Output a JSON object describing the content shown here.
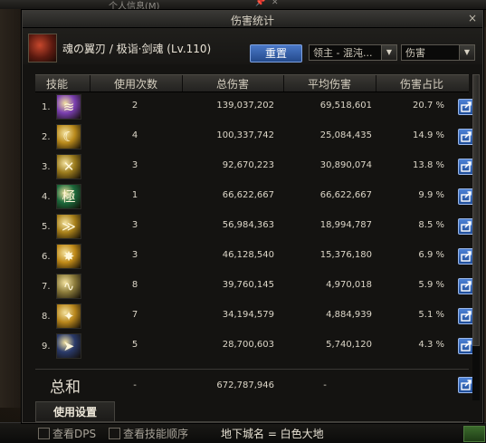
{
  "background": {
    "window_title": "个人信息(M)",
    "checkboxes": [
      {
        "label": "查看DPS",
        "checked": false
      },
      {
        "label": "查看技能顺序",
        "checked": false
      }
    ],
    "dungeon_text": "地下城名 = 白色大地"
  },
  "dialog": {
    "title": "伤害统计",
    "close_symbol": "×",
    "character_name": "魂の翼刃 / 极诣·剑魂 (Lv.110)",
    "reset_label": "重置",
    "target_select": "领主 - 混沌...",
    "metric_select": "伤害",
    "select_arrow": "▼",
    "columns": [
      "技能",
      "使用次数",
      "总伤害",
      "平均伤害",
      "伤害占比"
    ],
    "rows": [
      {
        "rank": "1.",
        "icon": "slash-wave-icon",
        "color": "#7a3fb0",
        "uses": "2",
        "total": "139,037,202",
        "avg": "69,518,601",
        "pct": "20.7 %"
      },
      {
        "rank": "2.",
        "icon": "crescent-slash-icon",
        "color": "#b98a1c",
        "uses": "4",
        "total": "100,337,742",
        "avg": "25,084,435",
        "pct": "14.9 %"
      },
      {
        "rank": "3.",
        "icon": "cross-blade-icon",
        "color": "#9a7a1c",
        "uses": "3",
        "total": "92,670,223",
        "avg": "30,890,074",
        "pct": "13.8 %"
      },
      {
        "rank": "4.",
        "icon": "kanji-ultimate-icon",
        "color": "#1c6a3c",
        "uses": "1",
        "total": "66,622,667",
        "avg": "66,622,667",
        "pct": "9.9 %"
      },
      {
        "rank": "5.",
        "icon": "triple-wave-icon",
        "color": "#a8801a",
        "uses": "3",
        "total": "56,984,363",
        "avg": "18,994,787",
        "pct": "8.5 %"
      },
      {
        "rank": "6.",
        "icon": "burst-strike-icon",
        "color": "#c08a18",
        "uses": "3",
        "total": "46,128,540",
        "avg": "15,376,180",
        "pct": "6.9 %"
      },
      {
        "rank": "7.",
        "icon": "flowing-blade-icon",
        "color": "#8a7a3a",
        "uses": "8",
        "total": "39,760,145",
        "avg": "4,970,018",
        "pct": "5.9 %"
      },
      {
        "rank": "8.",
        "icon": "dragon-strike-icon",
        "color": "#b8861c",
        "uses": "7",
        "total": "34,194,579",
        "avg": "4,884,939",
        "pct": "5.1 %"
      },
      {
        "rank": "9.",
        "icon": "sword-dash-icon",
        "color": "#2a3a6a",
        "uses": "5",
        "total": "28,700,603",
        "avg": "5,740,120",
        "pct": "4.3 %"
      }
    ],
    "summary": {
      "label": "总和",
      "uses": "-",
      "total": "672,787,946",
      "avg": "-"
    },
    "footer_tab": "使用设置"
  },
  "colors": {
    "accent_button": "#3a66b8",
    "share_button": "#3a6fc4"
  }
}
